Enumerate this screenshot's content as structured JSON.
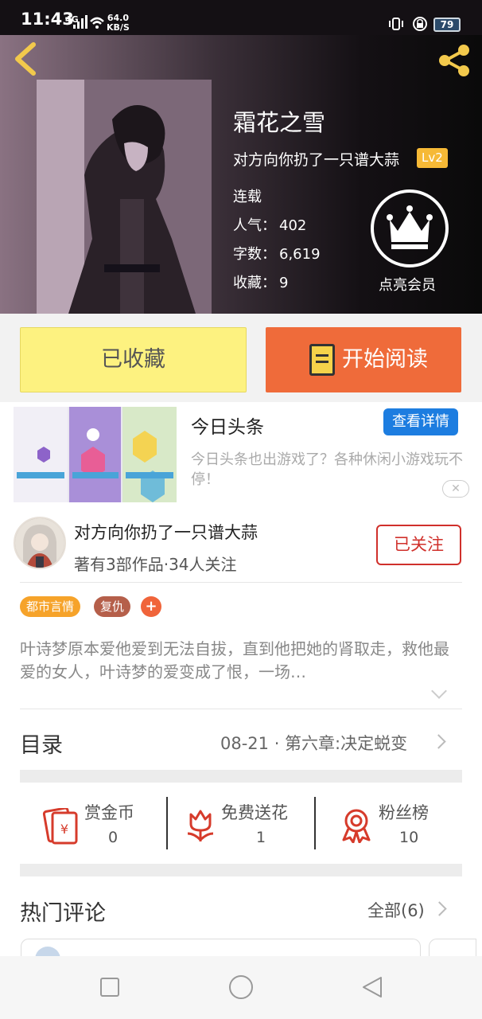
{
  "status_bar": {
    "time": "11:43",
    "network": "4G",
    "speed_value": "64.0",
    "speed_unit": "KB/S",
    "battery": "79"
  },
  "book": {
    "title": "霜花之雪",
    "author": "对方向你扔了一只谱大蒜",
    "author_level": "Lv2",
    "status": "连载",
    "popularity_label": "人气：",
    "popularity": "402",
    "word_count_label": "字数：",
    "word_count": "6,619",
    "favorites_label": "收藏：",
    "favorites": "9",
    "vip_label": "点亮会员"
  },
  "actions": {
    "collected_label": "已收藏",
    "read_label": "开始阅读"
  },
  "ad": {
    "title": "今日头条",
    "detail_button": "查看详情",
    "description": "今日头条也出游戏了？各种休闲小游戏玩不停！",
    "close_symbol": "✕"
  },
  "author_card": {
    "name": "对方向你扔了一只谱大蒜",
    "stats": "著有3部作品·34人关注",
    "follow_label": "已关注"
  },
  "tags": [
    {
      "label": "都市言情",
      "color": "#f6a32a"
    },
    {
      "label": "复仇",
      "color": "#b55f4a"
    }
  ],
  "tag_add_symbol": "+",
  "synopsis": "叶诗梦原本爱他爱到无法自拔，直到他把她的肾取走，救他最爱的女人，叶诗梦的爱变成了恨，一场…",
  "toc": {
    "title": "目录",
    "latest": "08-21 · 第六章:决定蜕变"
  },
  "stats": [
    {
      "label": "赏金币",
      "value": "0",
      "icon": "reward-coin-icon"
    },
    {
      "label": "免费送花",
      "value": "1",
      "icon": "flower-icon"
    },
    {
      "label": "粉丝榜",
      "value": "10",
      "icon": "medal-icon"
    }
  ],
  "comments": {
    "title": "热门评论",
    "all_label": "全部(6)"
  },
  "colors": {
    "accent_orange": "#ef6b3a",
    "collected_yellow": "#fdf280",
    "follow_red": "#d0302b",
    "detail_blue": "#1d7de0"
  }
}
